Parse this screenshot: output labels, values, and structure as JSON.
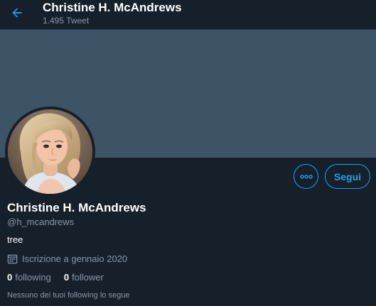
{
  "header": {
    "title": "Christine H. McAndrews",
    "tweet_count": "1.495 Tweet"
  },
  "profile": {
    "name": "Christine H. McAndrews",
    "handle": "@h_mcandrews",
    "bio": "tree",
    "joined": "Iscrizione a gennaio 2020",
    "following_count": "0",
    "following_label": "following",
    "follower_count": "0",
    "follower_label": "follower",
    "followed_by_note": "Nessuno dei tuoi following lo segue"
  },
  "actions": {
    "follow_label": "Segui"
  },
  "icons": {
    "back": "arrow-left-icon",
    "more": "more-horizontal-icon",
    "calendar": "calendar-icon"
  },
  "colors": {
    "background": "#15202b",
    "banner": "#3d5466",
    "accent": "#1da1f2",
    "secondary_text": "#8899a6"
  }
}
